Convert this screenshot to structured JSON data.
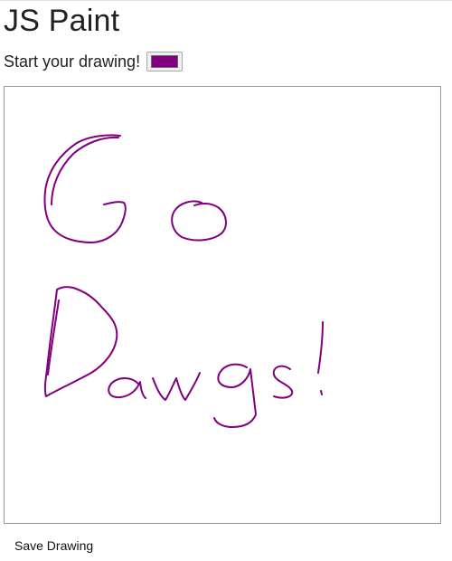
{
  "app": {
    "title": "JS Paint"
  },
  "toolbar": {
    "prompt": "Start your drawing!",
    "color_value": "#800080"
  },
  "canvas": {
    "stroke_color": "#800080",
    "drawn_text": "Go Dawgs!"
  },
  "footer": {
    "save_label": "Save Drawing"
  }
}
